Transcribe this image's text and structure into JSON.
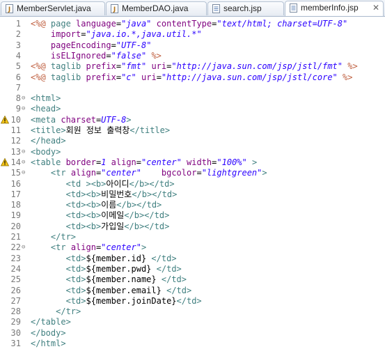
{
  "tabs": [
    {
      "label": "MemberServlet.java",
      "icon": "java-file-icon",
      "active": false
    },
    {
      "label": "MemberDAO.java",
      "icon": "java-file-icon",
      "active": false
    },
    {
      "label": "search.jsp",
      "icon": "jsp-file-icon",
      "active": false
    },
    {
      "label": "memberInfo.jsp",
      "icon": "jsp-file-icon",
      "active": true
    }
  ],
  "close_symbol": "✕",
  "colors": {
    "tag": "#3f7f7f",
    "attr": "#7f007f",
    "string": "#2a00ff",
    "directive": "#bf5f3f",
    "text": "#000000"
  },
  "lines": [
    {
      "n": "1",
      "fold": "",
      "warn": false,
      "tokens": [
        [
          "d",
          "<%@ "
        ],
        [
          "t",
          "page "
        ],
        [
          "a",
          "language"
        ],
        [
          "n",
          "="
        ],
        [
          "s",
          "\"java\""
        ],
        [
          "n",
          " "
        ],
        [
          "a",
          "contentType"
        ],
        [
          "n",
          "="
        ],
        [
          "s",
          "\"text/html; charset=UTF-8\""
        ]
      ]
    },
    {
      "n": "2",
      "fold": "",
      "warn": false,
      "tokens": [
        [
          "n",
          "    "
        ],
        [
          "a",
          "import"
        ],
        [
          "n",
          "="
        ],
        [
          "s",
          "\"java.io.*,java.util.*\""
        ]
      ]
    },
    {
      "n": "3",
      "fold": "",
      "warn": false,
      "tokens": [
        [
          "n",
          "    "
        ],
        [
          "a",
          "pageEncoding"
        ],
        [
          "n",
          "="
        ],
        [
          "s",
          "\"UTF-8\""
        ]
      ]
    },
    {
      "n": "4",
      "fold": "",
      "warn": false,
      "tokens": [
        [
          "n",
          "    "
        ],
        [
          "a",
          "isELIgnored"
        ],
        [
          "n",
          "="
        ],
        [
          "s",
          "\"false\""
        ],
        [
          "n",
          " "
        ],
        [
          "d",
          "%>"
        ]
      ]
    },
    {
      "n": "5",
      "fold": "",
      "warn": false,
      "tokens": [
        [
          "d",
          "<%@ "
        ],
        [
          "t",
          "taglib "
        ],
        [
          "a",
          "prefix"
        ],
        [
          "n",
          "="
        ],
        [
          "s",
          "\"fmt\""
        ],
        [
          "n",
          " "
        ],
        [
          "a",
          "uri"
        ],
        [
          "n",
          "="
        ],
        [
          "s",
          "\"http://java.sun.com/jsp/jstl/fmt\""
        ],
        [
          "n",
          " "
        ],
        [
          "d",
          "%>"
        ]
      ]
    },
    {
      "n": "6",
      "fold": "",
      "warn": false,
      "tokens": [
        [
          "d",
          "<%@ "
        ],
        [
          "t",
          "taglib "
        ],
        [
          "a",
          "prefix"
        ],
        [
          "n",
          "="
        ],
        [
          "s",
          "\"c\""
        ],
        [
          "n",
          " "
        ],
        [
          "a",
          "uri"
        ],
        [
          "n",
          "="
        ],
        [
          "s",
          "\"http://java.sun.com/jsp/jstl/core\""
        ],
        [
          "n",
          " "
        ],
        [
          "d",
          "%>"
        ]
      ]
    },
    {
      "n": "7",
      "fold": "",
      "warn": false,
      "tokens": []
    },
    {
      "n": "8",
      "fold": "⊖",
      "warn": false,
      "tokens": [
        [
          "t",
          "<html>"
        ]
      ]
    },
    {
      "n": "9",
      "fold": "⊖",
      "warn": false,
      "tokens": [
        [
          "t",
          "<head>"
        ]
      ]
    },
    {
      "n": "10",
      "fold": "",
      "warn": true,
      "tokens": [
        [
          "t",
          "<meta "
        ],
        [
          "a",
          "charset"
        ],
        [
          "n",
          "="
        ],
        [
          "s",
          "UTF-8"
        ],
        [
          "t",
          ">"
        ]
      ]
    },
    {
      "n": "11",
      "fold": "",
      "warn": false,
      "tokens": [
        [
          "t",
          "<title>"
        ],
        [
          "n",
          "회원 정보 출력창"
        ],
        [
          "t",
          "</title>"
        ]
      ]
    },
    {
      "n": "12",
      "fold": "",
      "warn": false,
      "tokens": [
        [
          "t",
          "</head>"
        ]
      ]
    },
    {
      "n": "13",
      "fold": "⊖",
      "warn": false,
      "tokens": [
        [
          "t",
          "<body>"
        ]
      ]
    },
    {
      "n": "14",
      "fold": "⊖",
      "warn": true,
      "tokens": [
        [
          "t",
          "<table "
        ],
        [
          "a",
          "border"
        ],
        [
          "n",
          "="
        ],
        [
          "s",
          "1"
        ],
        [
          "n",
          " "
        ],
        [
          "a",
          "align"
        ],
        [
          "n",
          "="
        ],
        [
          "s",
          "\"center\""
        ],
        [
          "n",
          " "
        ],
        [
          "a",
          "width"
        ],
        [
          "n",
          "="
        ],
        [
          "s",
          "\"100%\""
        ],
        [
          "n",
          " "
        ],
        [
          "t",
          ">"
        ]
      ]
    },
    {
      "n": "15",
      "fold": "⊖",
      "warn": false,
      "tokens": [
        [
          "n",
          "    "
        ],
        [
          "t",
          "<tr "
        ],
        [
          "a",
          "align"
        ],
        [
          "n",
          "="
        ],
        [
          "s",
          "\"center\""
        ],
        [
          "n",
          "    "
        ],
        [
          "a",
          "bgcolor"
        ],
        [
          "n",
          "="
        ],
        [
          "s",
          "\"lightgreen\""
        ],
        [
          "t",
          ">"
        ]
      ]
    },
    {
      "n": "16",
      "fold": "",
      "warn": false,
      "tokens": [
        [
          "n",
          "       "
        ],
        [
          "t",
          "<td "
        ],
        [
          "t",
          "><b>"
        ],
        [
          "n",
          "아이디"
        ],
        [
          "t",
          "</b></td>"
        ]
      ]
    },
    {
      "n": "17",
      "fold": "",
      "warn": false,
      "tokens": [
        [
          "n",
          "       "
        ],
        [
          "t",
          "<td><b>"
        ],
        [
          "n",
          "비밀번호"
        ],
        [
          "t",
          "</b></td>"
        ]
      ]
    },
    {
      "n": "18",
      "fold": "",
      "warn": false,
      "tokens": [
        [
          "n",
          "       "
        ],
        [
          "t",
          "<td><b>"
        ],
        [
          "n",
          "이름"
        ],
        [
          "t",
          "</b></td>"
        ]
      ]
    },
    {
      "n": "19",
      "fold": "",
      "warn": false,
      "tokens": [
        [
          "n",
          "       "
        ],
        [
          "t",
          "<td><b>"
        ],
        [
          "n",
          "이메일"
        ],
        [
          "t",
          "</b></td>"
        ]
      ]
    },
    {
      "n": "20",
      "fold": "",
      "warn": false,
      "tokens": [
        [
          "n",
          "       "
        ],
        [
          "t",
          "<td><b>"
        ],
        [
          "n",
          "가입일"
        ],
        [
          "t",
          "</b></td>"
        ]
      ]
    },
    {
      "n": "21",
      "fold": "",
      "warn": false,
      "tokens": [
        [
          "n",
          "    "
        ],
        [
          "t",
          "</tr>"
        ]
      ]
    },
    {
      "n": "22",
      "fold": "⊖",
      "warn": false,
      "tokens": [
        [
          "n",
          "    "
        ],
        [
          "t",
          "<tr "
        ],
        [
          "a",
          "align"
        ],
        [
          "n",
          "="
        ],
        [
          "s",
          "\"center\""
        ],
        [
          "t",
          ">"
        ]
      ]
    },
    {
      "n": "23",
      "fold": "",
      "warn": false,
      "tokens": [
        [
          "n",
          "       "
        ],
        [
          "t",
          "<td>"
        ],
        [
          "n",
          "${member.id}"
        ],
        [
          "n",
          " "
        ],
        [
          "t",
          "</td>"
        ]
      ]
    },
    {
      "n": "24",
      "fold": "",
      "warn": false,
      "tokens": [
        [
          "n",
          "       "
        ],
        [
          "t",
          "<td>"
        ],
        [
          "n",
          "${member.pwd}"
        ],
        [
          "n",
          " "
        ],
        [
          "t",
          "</td>"
        ]
      ]
    },
    {
      "n": "25",
      "fold": "",
      "warn": false,
      "tokens": [
        [
          "n",
          "       "
        ],
        [
          "t",
          "<td>"
        ],
        [
          "n",
          "${member.name}"
        ],
        [
          "n",
          " "
        ],
        [
          "t",
          "</td>"
        ]
      ]
    },
    {
      "n": "26",
      "fold": "",
      "warn": false,
      "tokens": [
        [
          "n",
          "       "
        ],
        [
          "t",
          "<td>"
        ],
        [
          "n",
          "${member.email}"
        ],
        [
          "n",
          " "
        ],
        [
          "t",
          "</td>"
        ]
      ]
    },
    {
      "n": "27",
      "fold": "",
      "warn": false,
      "tokens": [
        [
          "n",
          "       "
        ],
        [
          "t",
          "<td>"
        ],
        [
          "n",
          "${member.joinDate}"
        ],
        [
          "t",
          "</td>"
        ]
      ]
    },
    {
      "n": "28",
      "fold": "",
      "warn": false,
      "tokens": [
        [
          "n",
          "     "
        ],
        [
          "t",
          "</tr>"
        ]
      ]
    },
    {
      "n": "29",
      "fold": "",
      "warn": false,
      "tokens": [
        [
          "t",
          "</table>"
        ]
      ]
    },
    {
      "n": "30",
      "fold": "",
      "warn": false,
      "tokens": [
        [
          "t",
          "</body>"
        ]
      ]
    },
    {
      "n": "31",
      "fold": "",
      "warn": false,
      "tokens": [
        [
          "t",
          "</html>"
        ]
      ]
    }
  ]
}
